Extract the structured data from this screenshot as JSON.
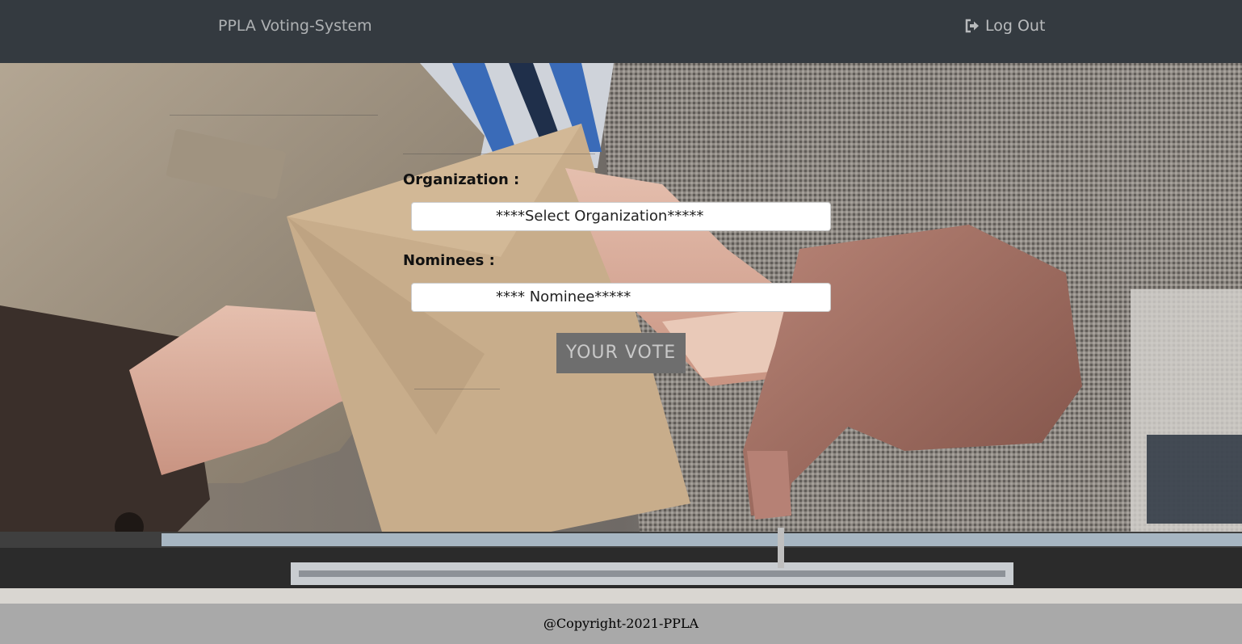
{
  "navbar": {
    "brand": "PPLA Voting-System",
    "logout_label": "Log Out",
    "logout_icon": "sign-out-icon"
  },
  "form": {
    "organization_label": "Organization :",
    "organization_value": "****Select Organization*****",
    "nominees_label": "Nominees :",
    "nominee_value": "**** Nominee*****",
    "vote_button": "YOUR VOTE"
  },
  "footer": {
    "copyright": "@Copyright-2021-PPLA"
  },
  "colors": {
    "navbar_bg": "#343a40",
    "footer_bg": "#a9a9a9",
    "button_bg": "#6e6e6e"
  }
}
